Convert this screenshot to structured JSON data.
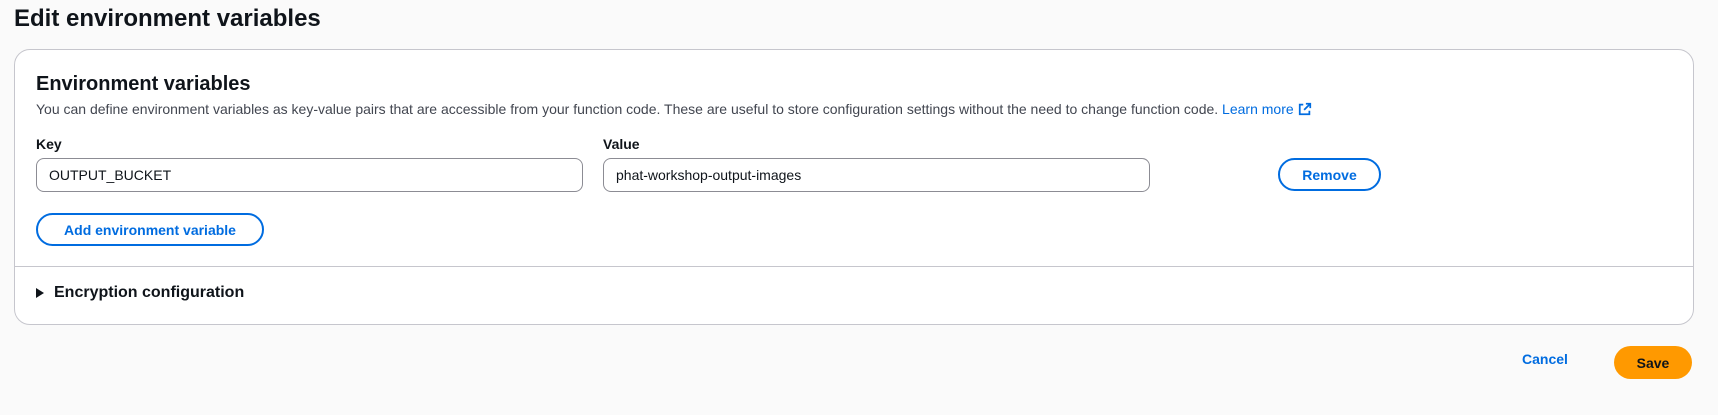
{
  "page": {
    "title": "Edit environment variables"
  },
  "env_section": {
    "title": "Environment variables",
    "description": "You can define environment variables as key-value pairs that are accessible from your function code. These are useful to store configuration settings without the need to change function code.",
    "learn_more": "Learn more",
    "key_label": "Key",
    "value_label": "Value",
    "variables": [
      {
        "key": "OUTPUT_BUCKET",
        "value": "phat-workshop-output-images"
      }
    ],
    "remove_label": "Remove",
    "add_label": "Add environment variable"
  },
  "encryption": {
    "label": "Encryption configuration",
    "expanded": false
  },
  "footer": {
    "cancel_label": "Cancel",
    "save_label": "Save"
  },
  "colors": {
    "link": "#006ce0",
    "primary_button": "#ff9900",
    "background": "#fafafa",
    "border": "#c6c6cd"
  },
  "icons": {
    "learn_more": "external-link-icon",
    "expander": "caret-right-icon"
  }
}
